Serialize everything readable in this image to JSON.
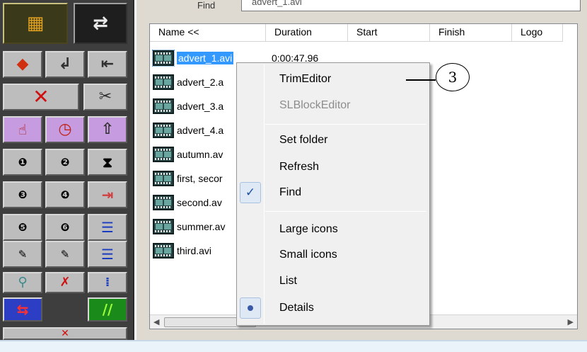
{
  "find": {
    "label": "Find",
    "value": "advert_1.avi"
  },
  "columns": [
    "Name <<",
    "Duration",
    "Start",
    "Finish",
    "Logo"
  ],
  "files": [
    {
      "name": "advert_1.avi",
      "duration": "0:00:47.96",
      "selected": true
    },
    {
      "name": "advert_2.a",
      "duration": ""
    },
    {
      "name": "advert_3.a",
      "duration": ""
    },
    {
      "name": "advert_4.a",
      "duration": ""
    },
    {
      "name": "autumn.av",
      "duration": ""
    },
    {
      "name": "first, secor",
      "duration": ""
    },
    {
      "name": "second.av",
      "duration": ""
    },
    {
      "name": "summer.av",
      "duration": ""
    },
    {
      "name": "third.avi",
      "duration": ""
    }
  ],
  "context_menu": {
    "items": [
      {
        "label": "TrimEditor",
        "enabled": true
      },
      {
        "label": "SLBlockEditor",
        "enabled": false
      },
      {
        "label": "Set folder",
        "enabled": true
      },
      {
        "label": "Refresh",
        "enabled": true
      },
      {
        "label": "Find",
        "enabled": true,
        "checked": true
      },
      {
        "label": "Large icons",
        "enabled": true
      },
      {
        "label": "Small icons",
        "enabled": true
      },
      {
        "label": "List",
        "enabled": true
      },
      {
        "label": "Details",
        "enabled": true,
        "radio_selected": true
      }
    ]
  },
  "callout": {
    "number": "3"
  },
  "toolbar": {
    "icons": [
      "film-strip-icon",
      "swap-arrows-icon",
      "arrow-left-icon",
      "enter-icon",
      "previous-icon",
      "delete-icon",
      "scissors-icon",
      "hand-pointer-icon",
      "clock-icon",
      "arrow-up-icon",
      "camera-1-icon",
      "camera-2-icon",
      "hourglass-icon",
      "camera-3-icon",
      "camera-4-icon",
      "insert-icon",
      "camera-5-icon",
      "camera-6-icon",
      "list-sort-down-icon",
      "edit-1-icon",
      "edit-2-icon",
      "list-sort-up-icon",
      "microphone-icon",
      "microphone-off-icon",
      "list-align-icon",
      "swap-red-blue-icon",
      "slash-icon"
    ],
    "accent_colors": {
      "selected": "#3399ff",
      "green": "#1a8a1a",
      "purple": "#c79be0"
    }
  }
}
